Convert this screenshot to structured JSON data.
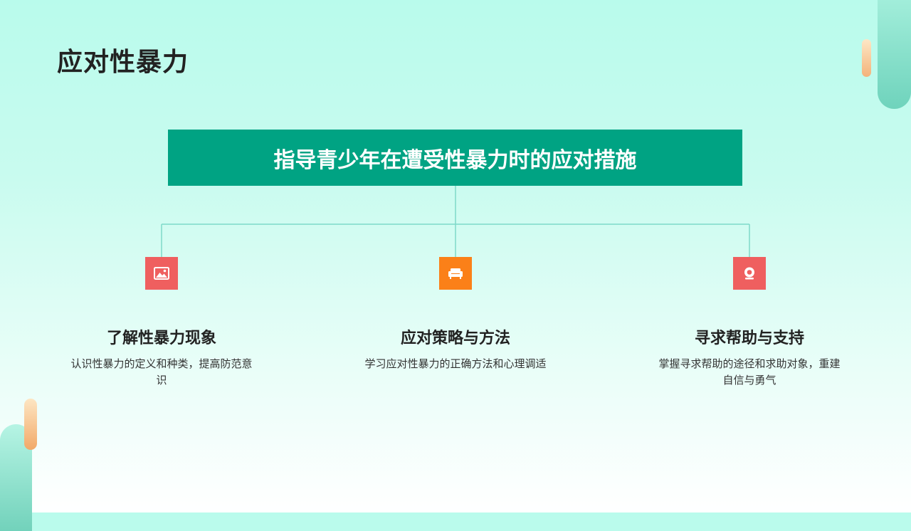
{
  "title": "应对性暴力",
  "banner": "指导青少年在遭受性暴力时的应对措施",
  "colors": {
    "banner": "#00a383",
    "connector": "#7ed9c9",
    "icon_red": "#ef5f5f",
    "icon_orange": "#fb8018"
  },
  "cards": [
    {
      "icon": "image-icon",
      "title": "了解性暴力现象",
      "desc": "认识性暴力的定义和种类，提高防范意识"
    },
    {
      "icon": "sofa-icon",
      "title": "应对策略与方法",
      "desc": "学习应对性暴力的正确方法和心理调适"
    },
    {
      "icon": "webcam-icon",
      "title": "寻求帮助与支持",
      "desc": "掌握寻求帮助的途径和求助对象，重建自信与勇气"
    }
  ]
}
